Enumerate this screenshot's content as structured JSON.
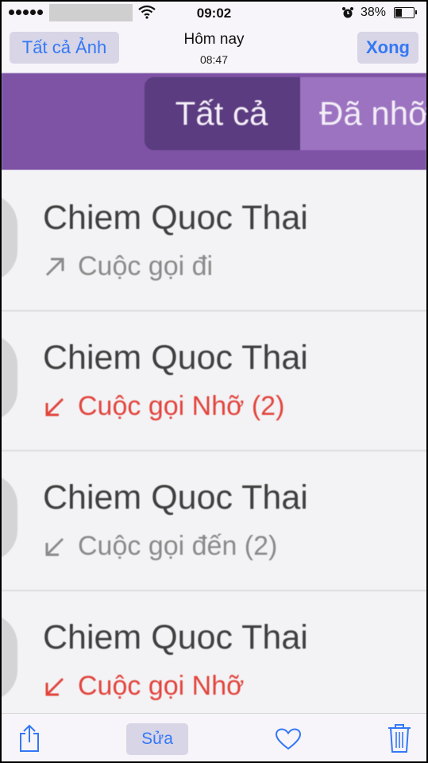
{
  "status_bar": {
    "time": "09:02",
    "battery_percent": "38%",
    "battery_level": 0.38,
    "signal_dots": 5
  },
  "nav_bar": {
    "back_label": "Tất cả Ảnh",
    "title": "Hôm nay",
    "subtitle": "08:47",
    "done_label": "Xong"
  },
  "segment": {
    "all_label": "Tất cả",
    "missed_label": "Đã nhỡ",
    "selected": "all"
  },
  "calls": [
    {
      "name": "Chiem Quoc Thai",
      "detail": "Cuộc gọi đi",
      "type": "outgoing",
      "color": "#8a8a8a"
    },
    {
      "name": "Chiem Quoc Thai",
      "detail": "Cuộc gọi Nhỡ (2)",
      "type": "missed",
      "color": "#e2443d"
    },
    {
      "name": "Chiem Quoc Thai",
      "detail": "Cuộc gọi đến (2)",
      "type": "incoming",
      "color": "#8a8a8a"
    },
    {
      "name": "Chiem Quoc Thai",
      "detail": "Cuộc gọi Nhỡ",
      "type": "missed",
      "color": "#e2443d"
    }
  ],
  "toolbar": {
    "share_icon": "share-icon",
    "edit_label": "Sửa",
    "favorite_icon": "heart-icon",
    "delete_icon": "trash-icon"
  },
  "colors": {
    "accent": "#3478f6",
    "header_purple": "#7e52a5",
    "missed_red": "#e2443d"
  }
}
